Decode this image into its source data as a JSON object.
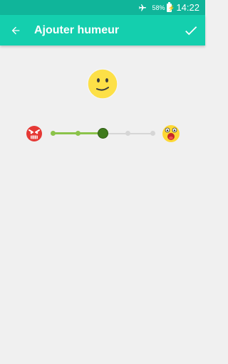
{
  "status_bar": {
    "battery_percent": "58%",
    "time": "14:22",
    "airplane_icon": "airplane-icon",
    "battery_icon": "battery-charging-icon"
  },
  "app_bar": {
    "title": "Ajouter humeur",
    "back_icon": "arrow-back-icon",
    "confirm_icon": "check-icon"
  },
  "mood": {
    "current_face": "neutral-smile-face-icon",
    "left_extreme": "angry-face-icon",
    "right_extreme": "excited-face-icon",
    "steps": 5,
    "selected_step": 3
  },
  "colors": {
    "status_bar": "#10b59a",
    "app_bar": "#14cfae",
    "background": "#f0f0f0",
    "track_active": "#8bc34a",
    "track_inactive": "#d6d6d6",
    "thumb": "#3f7a1c",
    "face_yellow": "#fde047"
  }
}
